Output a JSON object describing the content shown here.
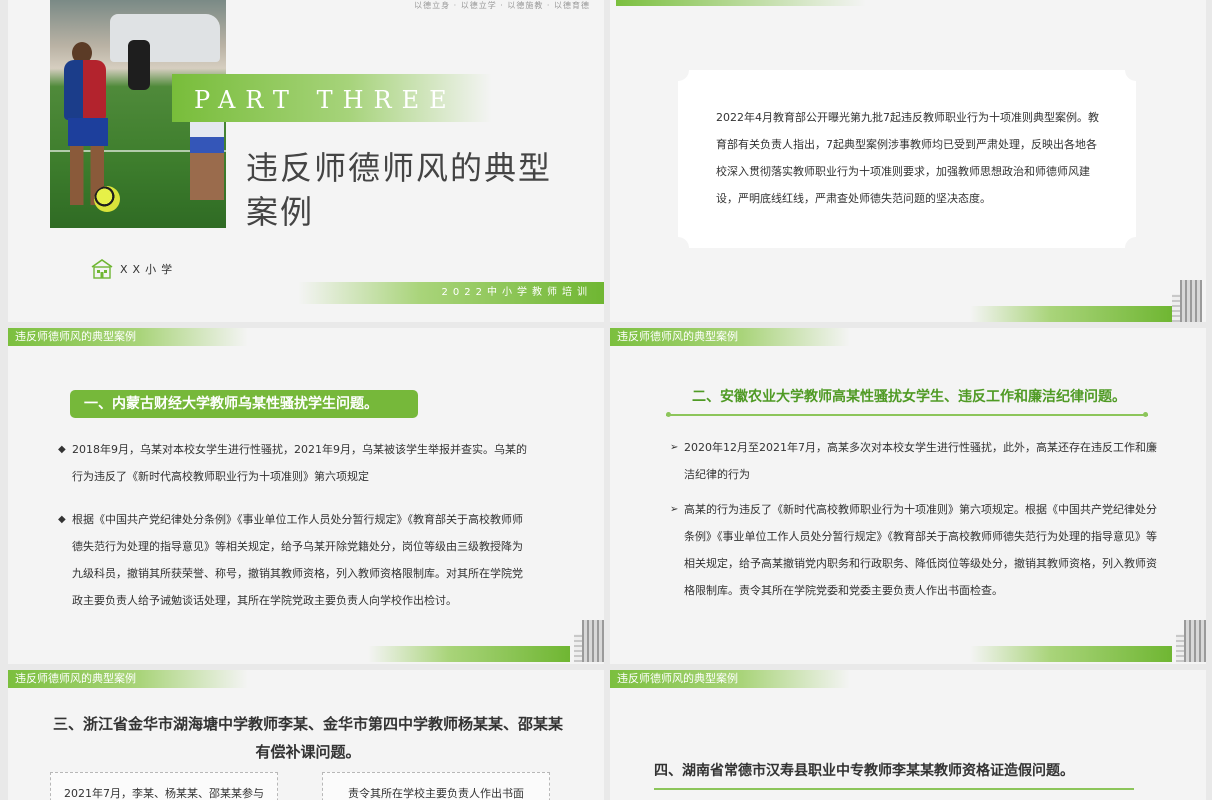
{
  "slides": {
    "s1": {
      "motto": "以德立身 · 以德立学 · 以德施教 · 以德育德",
      "part": "PART THREE",
      "title": "违反师德师风的典型案例",
      "school": "XX小学",
      "footer": "2022中小学教师培训"
    },
    "s2": {
      "paragraph": "2022年4月教育部公开曝光第九批7起违反教师职业行为十项准则典型案例。教育部有关负责人指出，7起典型案例涉事教师均已受到严肃处理，反映出各地各校深入贯彻落实教师职业行为十项准则要求，加强教师思想政治和师德师风建设，严明底线红线，严肃查处师德失范问题的坚决态度。"
    },
    "s3": {
      "tag": "违反师德师风的典型案例",
      "heading": "一、内蒙古财经大学教师乌某性骚扰学生问题。",
      "bullet_marker": "◆",
      "bullets": [
        "2018年9月，乌某对本校女学生进行性骚扰，2021年9月，乌某被该学生举报并查实。乌某的行为违反了《新时代高校教师职业行为十项准则》第六项规定",
        "根据《中国共产党纪律处分条例》《事业单位工作人员处分暂行规定》《教育部关于高校教师师德失范行为处理的指导意见》等相关规定，给予乌某开除党籍处分，岗位等级由三级教授降为九级科员，撤销其所获荣誉、称号，撤销其教师资格，列入教师资格限制库。对其所在学院党政主要负责人给予诫勉谈话处理，其所在学院党政主要负责人向学校作出检讨。"
      ]
    },
    "s4": {
      "tag": "违反师德师风的典型案例",
      "heading": "二、安徽农业大学教师高某性骚扰女学生、违反工作和廉洁纪律问题。",
      "bullet_marker": "➢",
      "bullets": [
        "2020年12月至2021年7月，高某多次对本校女学生进行性骚扰，此外，高某还存在违反工作和廉洁纪律的行为",
        "高某的行为违反了《新时代高校教师职业行为十项准则》第六项规定。根据《中国共产党纪律处分条例》《事业单位工作人员处分暂行规定》《教育部关于高校教师师德失范行为处理的指导意见》等相关规定，给予高某撤销党内职务和行政职务、降低岗位等级处分，撤销其教师资格，列入教师资格限制库。责令其所在学院党委和党委主要负责人作出书面检查。"
      ]
    },
    "s5": {
      "tag": "违反师德师风的典型案例",
      "heading": "三、浙江省金华市湖海塘中学教师李某、金华市第四中学教师杨某某、邵某某有偿补课问题。",
      "box_left": "2021年7月，李某、杨某某、邵某某参与",
      "box_right": "责令其所在学校主要负责人作出书面"
    },
    "s6": {
      "tag": "违反师德师风的典型案例",
      "heading": "四、湖南省常德市汉寿县职业中专教师李某某教师资格证造假问题。"
    }
  }
}
